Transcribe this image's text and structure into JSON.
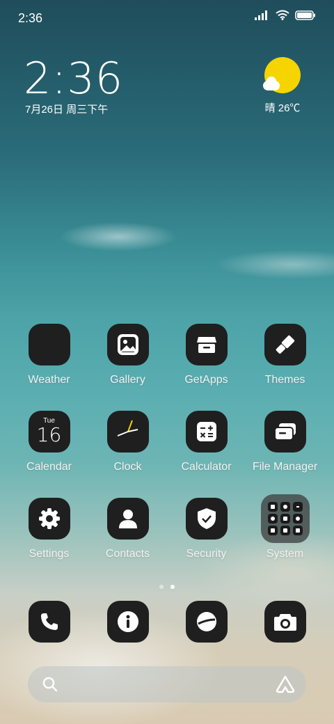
{
  "status_bar": {
    "time": "2:36",
    "icons": [
      "signal-icon",
      "wifi-icon",
      "battery-icon"
    ]
  },
  "clock_widget": {
    "time": "2:36",
    "date": "7月26日 周三下午"
  },
  "weather_widget": {
    "condition": "晴",
    "temperature": "26℃",
    "icon": "sun-cloud-icon"
  },
  "apps": {
    "row1": [
      {
        "label": "Weather",
        "icon": "blank-icon"
      },
      {
        "label": "Gallery",
        "icon": "image-icon"
      },
      {
        "label": "GetApps",
        "icon": "store-icon"
      },
      {
        "label": "Themes",
        "icon": "brush-icon"
      }
    ],
    "row2": [
      {
        "label": "Calendar",
        "icon": "calendar-icon",
        "day": "Tue",
        "date": "16"
      },
      {
        "label": "Clock",
        "icon": "clock-icon"
      },
      {
        "label": "Calculator",
        "icon": "calculator-icon"
      },
      {
        "label": "File Manager",
        "icon": "folder-icon"
      }
    ],
    "row3": [
      {
        "label": "Settings",
        "icon": "gear-icon"
      },
      {
        "label": "Contacts",
        "icon": "person-icon"
      },
      {
        "label": "Security",
        "icon": "shield-icon"
      },
      {
        "label": "System",
        "icon": "folder-grid-icon"
      }
    ]
  },
  "page_indicator": {
    "pages": 2,
    "current": 2
  },
  "dock": [
    {
      "icon": "phone-icon"
    },
    {
      "icon": "info-icon"
    },
    {
      "icon": "browser-icon"
    },
    {
      "icon": "camera-icon"
    }
  ],
  "search_bar": {
    "left_icon": "search-icon",
    "right_icon": "assistant-icon"
  },
  "colors": {
    "icon_bg": "#1f1f1f",
    "sun": "#f5d400",
    "text": "#ffffff"
  }
}
